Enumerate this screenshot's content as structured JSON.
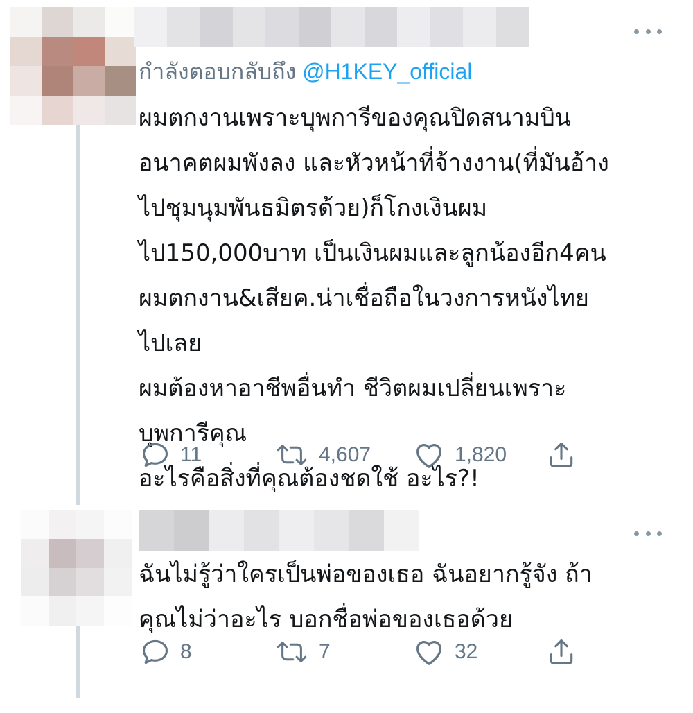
{
  "tweets": [
    {
      "reply_prefix": "กำลังตอบกลับถึง",
      "reply_handle": "@H1KEY_official",
      "lines": [
        "ผมตกงานเพราะบุพการีของคุณปิดสนามบิน",
        "อนาคตผมพังลง และหัวหน้าที่จ้างงาน(ที่มันอ้าง",
        "ไปชุมนุมพันธมิตรด้วย)ก็โกงเงินผม",
        "ไป150,000บาท เป็นเงินผมและลูกน้องอีก4คน",
        "ผมตกงาน&เสียค.น่าเชื่อถือในวงการหนังไทย",
        "ไปเลย",
        "ผมต้องหาอาชีพอื่นทำ ชีวิตผมเปลี่ยนเพราะ",
        "บุพการีคุณ",
        "อะไรคือสิ่งที่คุณต้องชดใช้ อะไร?!"
      ],
      "counts": {
        "replies": "11",
        "retweets": "4,607",
        "likes": "1,820"
      }
    },
    {
      "lines": [
        "ฉันไม่รู้ว่าใครเป็นพ่อของเธอ ฉันอยากรู้จัง ถ้า",
        "คุณไม่ว่าอะไร บอกชื่อพ่อของเธอด้วย"
      ],
      "counts": {
        "replies": "8",
        "retweets": "7",
        "likes": "32"
      }
    }
  ],
  "icons": {
    "reply": "reply-icon",
    "retweet": "retweet-icon",
    "like": "heart-icon",
    "share": "share-icon",
    "more": "more-options-icon"
  },
  "colors": {
    "text": "#14171a",
    "muted": "#657786",
    "link": "#1da1f2",
    "thread_line": "#cfd9de"
  }
}
